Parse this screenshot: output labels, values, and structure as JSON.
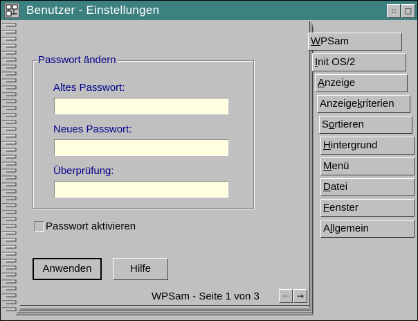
{
  "window": {
    "title": "Benutzer - Einstellungen",
    "restore_glyph": "::",
    "close_glyph": "□"
  },
  "group": {
    "title": "Passwort ändern"
  },
  "fields": {
    "old_label": "Altes Passwort:",
    "old_value": "",
    "new_label": "Neues Passwort:",
    "new_value": "",
    "verify_label": "Überprüfung:",
    "verify_value": ""
  },
  "checkbox": {
    "label": "Passwort aktivieren",
    "checked": false
  },
  "buttons": {
    "apply": "Anwenden",
    "help": "Hilfe"
  },
  "footer": {
    "page_info": "WPSam - Seite 1 von 3",
    "prev_glyph": "←",
    "next_glyph": "→"
  },
  "tabs": [
    {
      "pre": "",
      "ul": "W",
      "post": "PSam",
      "active": true
    },
    {
      "pre": "",
      "ul": "I",
      "post": "nit OS/2",
      "active": false
    },
    {
      "pre": "",
      "ul": "A",
      "post": "nzeige",
      "active": false
    },
    {
      "pre": "Anzeige",
      "ul": "k",
      "post": "riterien",
      "active": false
    },
    {
      "pre": "S",
      "ul": "o",
      "post": "rtieren",
      "active": false
    },
    {
      "pre": "",
      "ul": "H",
      "post": "intergrund",
      "active": false
    },
    {
      "pre": "",
      "ul": "M",
      "post": "enü",
      "active": false
    },
    {
      "pre": "",
      "ul": "D",
      "post": "atei",
      "active": false
    },
    {
      "pre": "",
      "ul": "F",
      "post": "enster",
      "active": false
    },
    {
      "pre": "A",
      "ul": "l",
      "post": "lgemein",
      "active": false
    }
  ]
}
